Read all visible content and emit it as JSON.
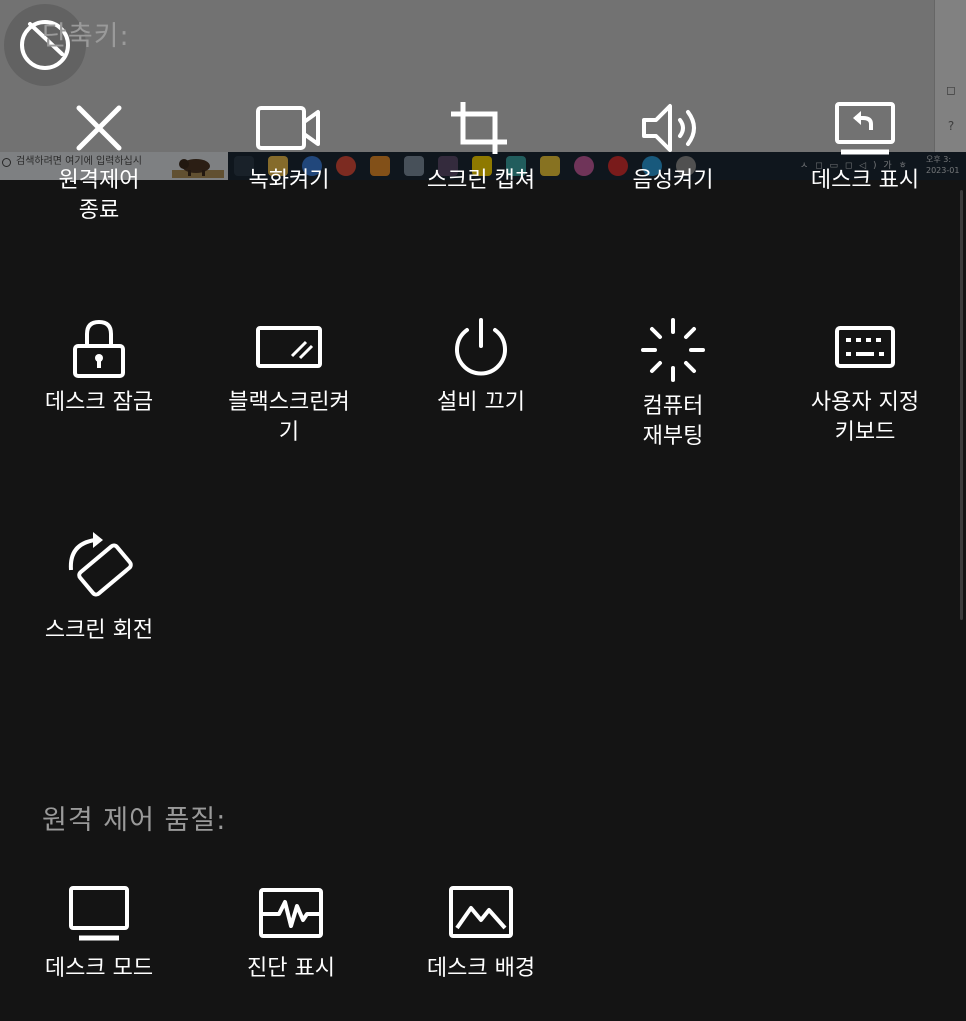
{
  "remote_desktop": {
    "taskbar_search_placeholder": "검색하려면 여기에 입력하십시",
    "tray_text": "ㅅ ◻ ▭ ◻ ◁ ) 가 ㅎ",
    "clock_line1": "오후 3:",
    "clock_line2": "2023-01",
    "side_icon_1": "◻",
    "side_icon_2": "?"
  },
  "sections": {
    "shortcuts_title": "단축키:",
    "quality_title": "원격 제어 품질:"
  },
  "shortcuts": [
    {
      "icon": "close-icon",
      "label_line1": "원격제어",
      "label_line2": "종료"
    },
    {
      "icon": "video-camera-icon",
      "label_line1": "녹화켜기",
      "label_line2": ""
    },
    {
      "icon": "crop-icon",
      "label_line1": "스크린 캡쳐",
      "label_line2": ""
    },
    {
      "icon": "speaker-icon",
      "label_line1": "음성켜기",
      "label_line2": ""
    },
    {
      "icon": "show-desktop-icon",
      "label_line1": "데스크 표시",
      "label_line2": ""
    },
    {
      "icon": "lock-icon",
      "label_line1": "데스크 잠금",
      "label_line2": ""
    },
    {
      "icon": "black-screen-icon",
      "label_line1": "블랙스크린켜",
      "label_line2": "기"
    },
    {
      "icon": "power-icon",
      "label_line1": "설비 끄기",
      "label_line2": ""
    },
    {
      "icon": "reboot-spinner-icon",
      "label_line1": "컴퓨터",
      "label_line2": "재부팅"
    },
    {
      "icon": "keyboard-icon",
      "label_line1": "사용자 지정",
      "label_line2": "키보드"
    },
    {
      "icon": "rotate-screen-icon",
      "label_line1": "스크린 회전",
      "label_line2": ""
    }
  ],
  "quality": [
    {
      "icon": "monitor-icon",
      "label": "데스크 모드"
    },
    {
      "icon": "diagnostics-icon",
      "label": "진단 표시"
    },
    {
      "icon": "wallpaper-icon",
      "label": "데스크 배경"
    }
  ],
  "colors": {
    "panel_bg": "#141414",
    "icon_white": "#ffffff",
    "section_title_gray": "#9a9a9a",
    "taskbar": "#1a2733"
  }
}
